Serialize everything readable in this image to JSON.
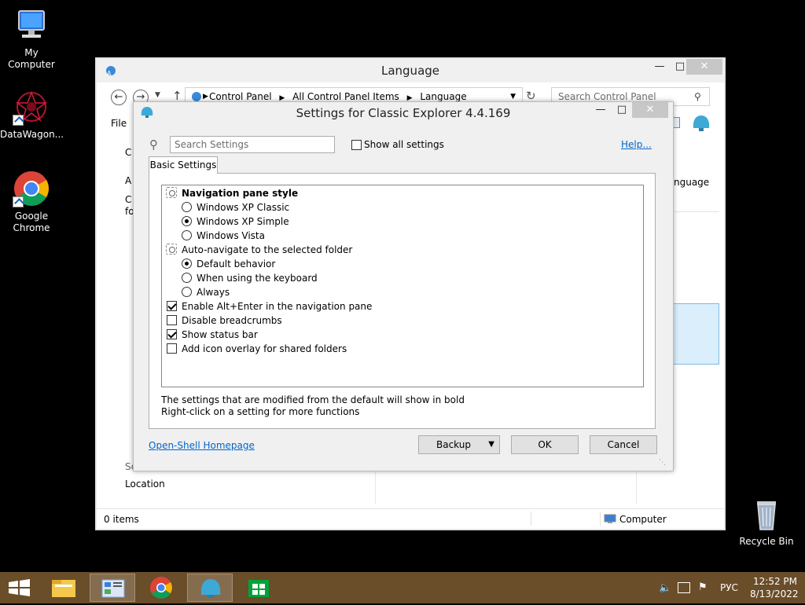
{
  "desktop": {
    "icons": [
      {
        "label": "My Computer"
      },
      {
        "label": "DataWagon..."
      },
      {
        "label": "Google Chrome"
      },
      {
        "label": "Recycle Bin"
      }
    ]
  },
  "language_window": {
    "title": "Language",
    "breadcrumb": [
      "Control Panel",
      "All Control Panel Items",
      "Language"
    ],
    "search_placeholder": "Search Control Panel",
    "menu_file": "File",
    "left_fragments": [
      "C",
      "A",
      "C",
      "fo"
    ],
    "right_fragment": "nguage",
    "bottom_left_fragment": "Se",
    "location_label": "Location",
    "status_items": "0 items",
    "status_computer": "Computer"
  },
  "dialog": {
    "title": "Settings for Classic Explorer 4.4.169",
    "search_placeholder": "Search Settings",
    "show_all_label": "Show all settings",
    "help_link": "Help...",
    "tab_label": "Basic Settings",
    "settings": {
      "nav_pane_style": "Navigation pane style",
      "opt_xp_classic": "Windows XP Classic",
      "opt_xp_simple": "Windows XP Simple",
      "opt_vista": "Windows Vista",
      "auto_navigate": "Auto-navigate to the selected folder",
      "opt_default": "Default behavior",
      "opt_keyboard": "When using the keyboard",
      "opt_always": "Always",
      "alt_enter": "Enable Alt+Enter in the navigation pane",
      "disable_breadcrumbs": "Disable breadcrumbs",
      "show_status_bar": "Show status bar",
      "icon_overlay": "Add icon overlay for shared folders"
    },
    "hint_line1": "The settings that are modified from the default will show in bold",
    "hint_line2": "Right-click on a setting for more functions",
    "homepage_link": "Open-Shell Homepage",
    "backup_label": "Backup",
    "ok_label": "OK",
    "cancel_label": "Cancel"
  },
  "taskbar": {
    "language": "РУС",
    "time": "12:52 PM",
    "date": "8/13/2022"
  },
  "colors": {
    "taskbar": "#6a4d29",
    "link": "#0066cc",
    "desktop": "#000000"
  }
}
